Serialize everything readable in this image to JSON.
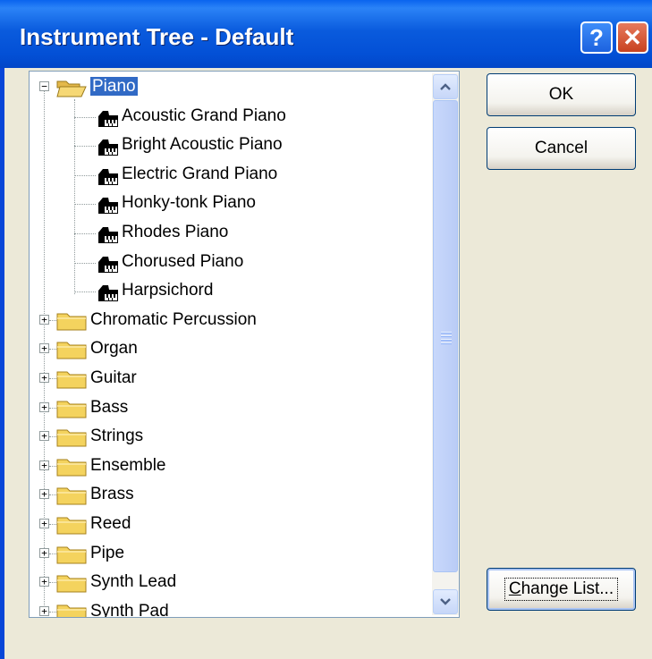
{
  "window": {
    "title": "Instrument Tree - Default",
    "help_glyph": "?",
    "close_glyph": "✕"
  },
  "tree": {
    "expanded_glyph": "−",
    "collapsed_glyph": "+",
    "expanded": {
      "label": "Piano",
      "selected": true
    },
    "piano_children": [
      "Acoustic Grand Piano",
      "Bright Acoustic Piano",
      "Electric Grand Piano",
      "Honky-tonk Piano",
      "Rhodes Piano",
      "Chorused Piano",
      "Harpsichord"
    ],
    "collapsed_groups": [
      "Chromatic Percussion",
      "Organ",
      "Guitar",
      "Bass",
      "Strings",
      "Ensemble",
      "Brass",
      "Reed",
      "Pipe",
      "Synth Lead",
      "Synth Pad"
    ]
  },
  "buttons": {
    "ok": "OK",
    "cancel": "Cancel",
    "change_list_mnemonic": "C",
    "change_list_rest": "hange List..."
  },
  "colors": {
    "title_bar": "#0A5BDD",
    "selection": "#316AC5",
    "folder": "#F4D35E",
    "dialog_bg": "#ECE9D8"
  }
}
